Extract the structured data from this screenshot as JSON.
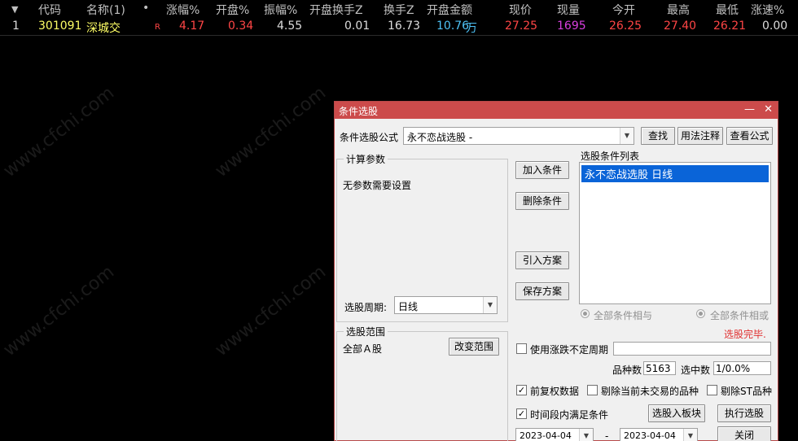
{
  "table": {
    "headers": {
      "sort": "▼",
      "code": "代码",
      "name": "名称(1)",
      "dot": "•",
      "change_pct": "涨幅%",
      "open_pct": "开盘%",
      "amplitude": "振幅%",
      "open_turnover": "开盘换手Z",
      "turnover": "换手Z",
      "open_amount": "开盘金额",
      "price": "现价",
      "volume": "现量",
      "today_open": "今开",
      "high": "最高",
      "low": "最低",
      "speed": "涨速%"
    },
    "row": {
      "index": "1",
      "code": "301091",
      "name": "深城交",
      "flag": "R",
      "change_pct": "4.17",
      "open_pct": "0.34",
      "amplitude": "4.55",
      "open_turnover": "0.01",
      "turnover": "16.73",
      "open_amount": "10.76",
      "open_amount_unit": "万",
      "price": "27.25",
      "volume": "1695",
      "today_open": "26.25",
      "high": "27.40",
      "low": "26.21",
      "speed": "0.00"
    }
  },
  "watermark": "www.cfchi.com",
  "dialog": {
    "title": "条件选股",
    "minimize": "—",
    "close": "✕",
    "formula_label": "条件选股公式",
    "formula_value": "永不恋战选股 -",
    "search_btn": "查找",
    "usage_btn": "用法注释",
    "view_btn": "查看公式",
    "calc_group": "计算参数",
    "no_params": "无参数需要设置",
    "period_label": "选股周期:",
    "period_value": "日线",
    "add_btn": "加入条件",
    "delete_btn": "删除条件",
    "import_btn": "引入方案",
    "save_btn": "保存方案",
    "cond_list_label": "选股条件列表",
    "cond_items": [
      "永不恋战选股  日线"
    ],
    "radio_and": "全部条件相与",
    "radio_or": "全部条件相或",
    "status": "选股完毕.",
    "range_group": "选股范围",
    "range_value": "全部Ａ股",
    "change_range_btn": "改变范围",
    "use_period_label": "使用涨跌不定周期",
    "count_label": "品种数",
    "count_value": "5163",
    "selected_label": "选中数",
    "selected_value": "1/0.0%",
    "fq_label": "前复权数据",
    "exclude_untraded_label": "剔除当前未交易的品种",
    "exclude_st_label": "剔除ST品种",
    "timespan_label": "时间段内满足条件",
    "to_block_btn": "选股入板块",
    "run_btn": "执行选股",
    "date_from": "2023-04-04",
    "date_sep": "-",
    "date_to": "2023-04-04",
    "close_btn": "关闭",
    "check_mark": "✓"
  },
  "colors": {
    "up": "#ff4545",
    "code": "#ffff66",
    "amount": "#4fc3f7",
    "volume": "#d93fe0",
    "title_bar": "#cc4b4b",
    "status": "#e03030"
  }
}
